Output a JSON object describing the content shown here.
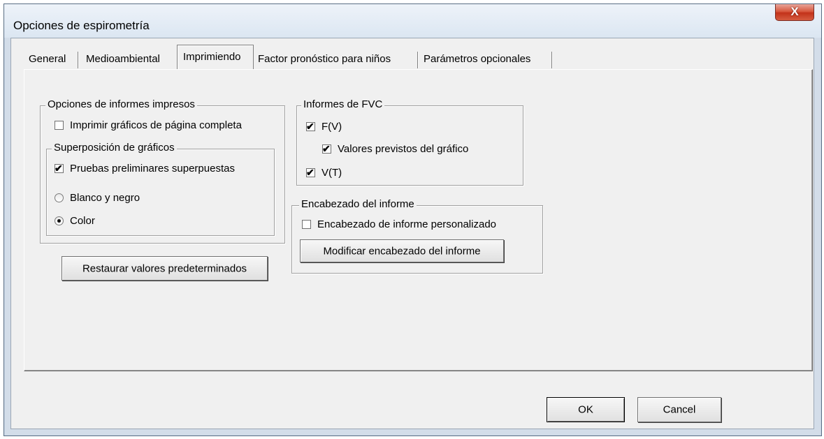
{
  "window": {
    "title": "Opciones de espirometría",
    "close_label": "X"
  },
  "tabs": [
    {
      "label": "General",
      "active": false
    },
    {
      "label": "Medioambiental",
      "active": false
    },
    {
      "label": "Imprimiendo",
      "active": true
    },
    {
      "label": "Factor pronóstico para niños",
      "active": false
    },
    {
      "label": "Parámetros opcionales",
      "active": false
    }
  ],
  "print_options": {
    "group_label": "Opciones de informes impresos",
    "full_page": {
      "label": "Imprimir gráficos de página completa",
      "checked": false
    },
    "overlay": {
      "group_label": "Superposición de gráficos",
      "preliminary": {
        "label": "Pruebas preliminares superpuestas",
        "checked": true
      },
      "bw": {
        "label": "Blanco y negro",
        "selected": false
      },
      "color": {
        "label": "Color",
        "selected": true
      }
    }
  },
  "fvc_reports": {
    "group_label": "Informes de FVC",
    "fv": {
      "label": "F(V)",
      "checked": true
    },
    "predicted": {
      "label": "Valores previstos del gráfico",
      "checked": true
    },
    "vt": {
      "label": "V(T)",
      "checked": true
    }
  },
  "report_header": {
    "group_label": "Encabezado del informe",
    "custom": {
      "label": "Encabezado de informe personalizado",
      "checked": false
    },
    "modify_button": "Modificar encabezado del informe"
  },
  "restore_button": "Restaurar valores predeterminados",
  "footer": {
    "ok": "OK",
    "cancel": "Cancel"
  },
  "check_glyph": "✔",
  "colors": {
    "titlebar": "#dbe6f2",
    "client": "#f0f0f0",
    "close": "#c2321a"
  }
}
